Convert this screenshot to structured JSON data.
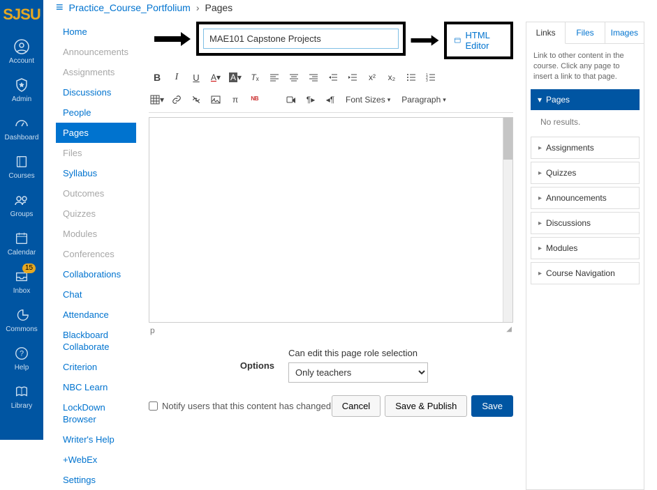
{
  "brand": "SJSU",
  "global_nav": {
    "items": [
      {
        "label": "Account",
        "icon": "account"
      },
      {
        "label": "Admin",
        "icon": "shield"
      },
      {
        "label": "Dashboard",
        "icon": "gauge"
      },
      {
        "label": "Courses",
        "icon": "book"
      },
      {
        "label": "Groups",
        "icon": "people"
      },
      {
        "label": "Calendar",
        "icon": "calendar"
      },
      {
        "label": "Inbox",
        "icon": "inbox",
        "badge": "15"
      },
      {
        "label": "Commons",
        "icon": "commons"
      },
      {
        "label": "Help",
        "icon": "help"
      },
      {
        "label": "Library",
        "icon": "lib"
      }
    ]
  },
  "breadcrumb": {
    "course": "Practice_Course_Portfolium",
    "page": "Pages"
  },
  "course_nav": {
    "items": [
      {
        "label": "Home"
      },
      {
        "label": "Announcements",
        "muted": true
      },
      {
        "label": "Assignments",
        "muted": true
      },
      {
        "label": "Discussions"
      },
      {
        "label": "People"
      },
      {
        "label": "Pages",
        "active": true
      },
      {
        "label": "Files",
        "muted": true
      },
      {
        "label": "Syllabus"
      },
      {
        "label": "Outcomes",
        "muted": true
      },
      {
        "label": "Quizzes",
        "muted": true
      },
      {
        "label": "Modules",
        "muted": true
      },
      {
        "label": "Conferences",
        "muted": true
      },
      {
        "label": "Collaborations"
      },
      {
        "label": "Chat"
      },
      {
        "label": "Attendance"
      },
      {
        "label": "Blackboard Collaborate"
      },
      {
        "label": "Criterion"
      },
      {
        "label": "NBC Learn"
      },
      {
        "label": "LockDown Browser"
      },
      {
        "label": "Writer's Help"
      },
      {
        "label": "+WebEx"
      },
      {
        "label": "Settings"
      }
    ]
  },
  "editor": {
    "title_value": "MAE101 Capstone Projects",
    "html_editor_label": "HTML Editor",
    "font_sizes": "Font Sizes",
    "paragraph": "Paragraph",
    "path": "p",
    "options_label": "Options",
    "edit_role_label": "Can edit this page role selection",
    "edit_role_value": "Only teachers",
    "notify_label": "Notify users that this content has changed",
    "cancel": "Cancel",
    "save_publish": "Save & Publish",
    "save": "Save"
  },
  "right": {
    "tabs": [
      "Links",
      "Files",
      "Images"
    ],
    "help_text": "Link to other content in the course. Click any page to insert a link to that page.",
    "expanded_title": "Pages",
    "expanded_empty": "No results.",
    "items": [
      "Assignments",
      "Quizzes",
      "Announcements",
      "Discussions",
      "Modules",
      "Course Navigation"
    ]
  }
}
